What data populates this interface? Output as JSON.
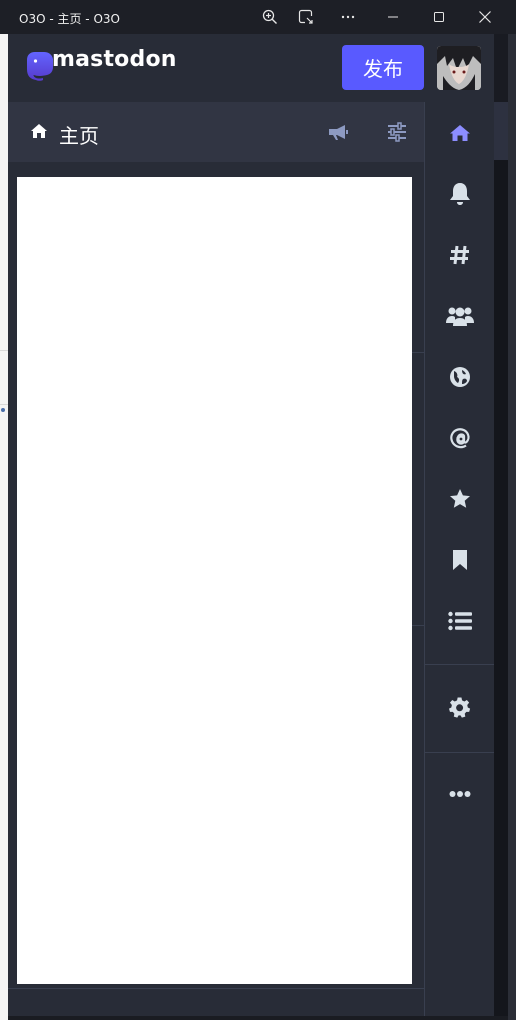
{
  "window": {
    "title": "O3O - 主页 - O3O"
  },
  "header": {
    "logo_text": "mastodon",
    "publish_label": "发布"
  },
  "column": {
    "title": "主页"
  },
  "nav": {
    "items": [
      "home",
      "notifications",
      "explore",
      "community",
      "federated",
      "mentions",
      "favourites",
      "bookmarks",
      "lists",
      "preferences",
      "more"
    ]
  },
  "colors": {
    "accent": "#595aff",
    "active_icon": "#8c8dff",
    "icon": "#d9e1e8",
    "header_bg": "#282c37",
    "column_header_bg": "#313543"
  }
}
